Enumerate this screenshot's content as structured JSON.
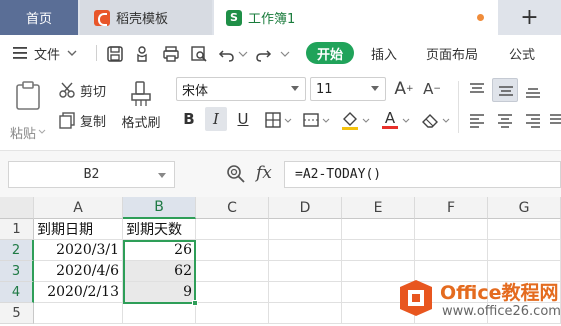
{
  "tabs": {
    "home": "首页",
    "template": "稻壳模板",
    "workbook": "工作簿1",
    "add": "+"
  },
  "menu": {
    "file": "文件",
    "start": "开始",
    "insert": "插入",
    "page_layout": "页面布局",
    "formula": "公式"
  },
  "ribbon": {
    "paste": "粘贴",
    "cut": "剪切",
    "copy": "复制",
    "format_painter": "格式刷",
    "font_name": "宋体",
    "font_size": "11",
    "bold": "B",
    "italic": "I",
    "underline": "U",
    "font_color_letter": "A"
  },
  "formula_bar": {
    "name_box": "B2",
    "fx": "fx",
    "formula": "=A2-TODAY()"
  },
  "grid": {
    "columns": [
      "A",
      "B",
      "C",
      "D",
      "E",
      "F",
      "G"
    ],
    "rows": [
      "1",
      "2",
      "3",
      "4",
      "5"
    ],
    "header_a": "到期日期",
    "header_b": "到期天数",
    "data": [
      {
        "date": "2020/3/1",
        "days": "26"
      },
      {
        "date": "2020/4/6",
        "days": "62"
      },
      {
        "date": "2020/2/13",
        "days": "9"
      }
    ]
  },
  "watermark": {
    "brand": "Office教程网",
    "site": "www.office26.com"
  },
  "colors": {
    "accent_green": "#20a35a",
    "selection_green": "#2e9e58",
    "home_tab": "#5a6e96",
    "watermark_orange": "#e46b1f"
  }
}
